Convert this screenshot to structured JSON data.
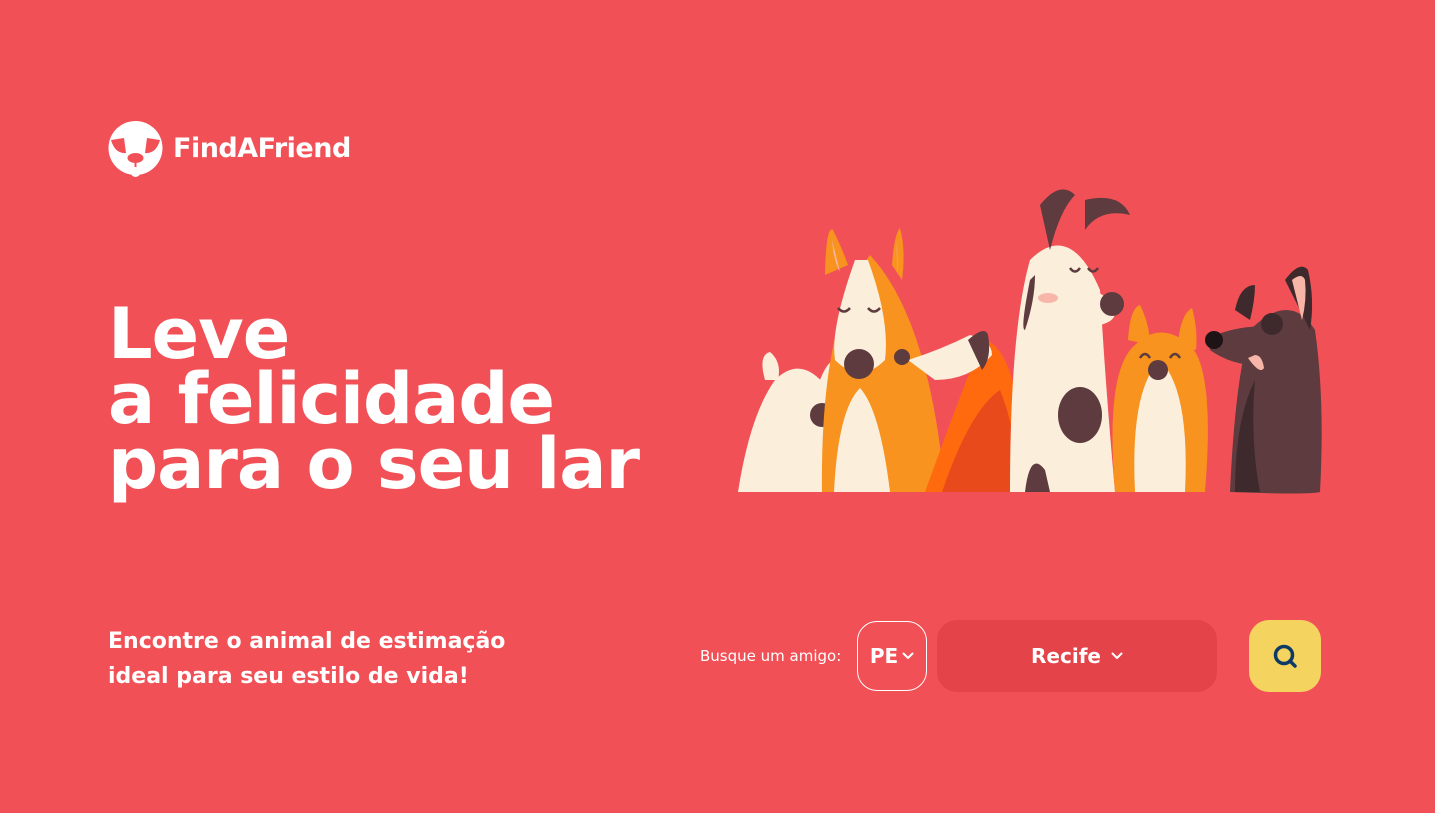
{
  "brand": {
    "name": "FindAFriend",
    "logo_icon": "dog-face-icon",
    "color": "#FFFFFF"
  },
  "hero": {
    "headline": [
      "Leve",
      "a felicidade",
      "para o seu lar"
    ],
    "subtitle": "Encontre o animal de estimação ideal para seu estilo de vida!",
    "illustration": "group-of-dogs-illustration"
  },
  "search": {
    "label": "Busque um amigo:",
    "state": {
      "value": "PE",
      "icon": "chevron-down-icon"
    },
    "city": {
      "value": "Recife",
      "icon": "chevron-down-icon"
    },
    "button_icon": "search-icon"
  },
  "colors": {
    "background": "#F15156",
    "city_select_bg": "#E44449",
    "search_button_bg": "#F4D35E",
    "search_icon": "#0D3B66"
  }
}
